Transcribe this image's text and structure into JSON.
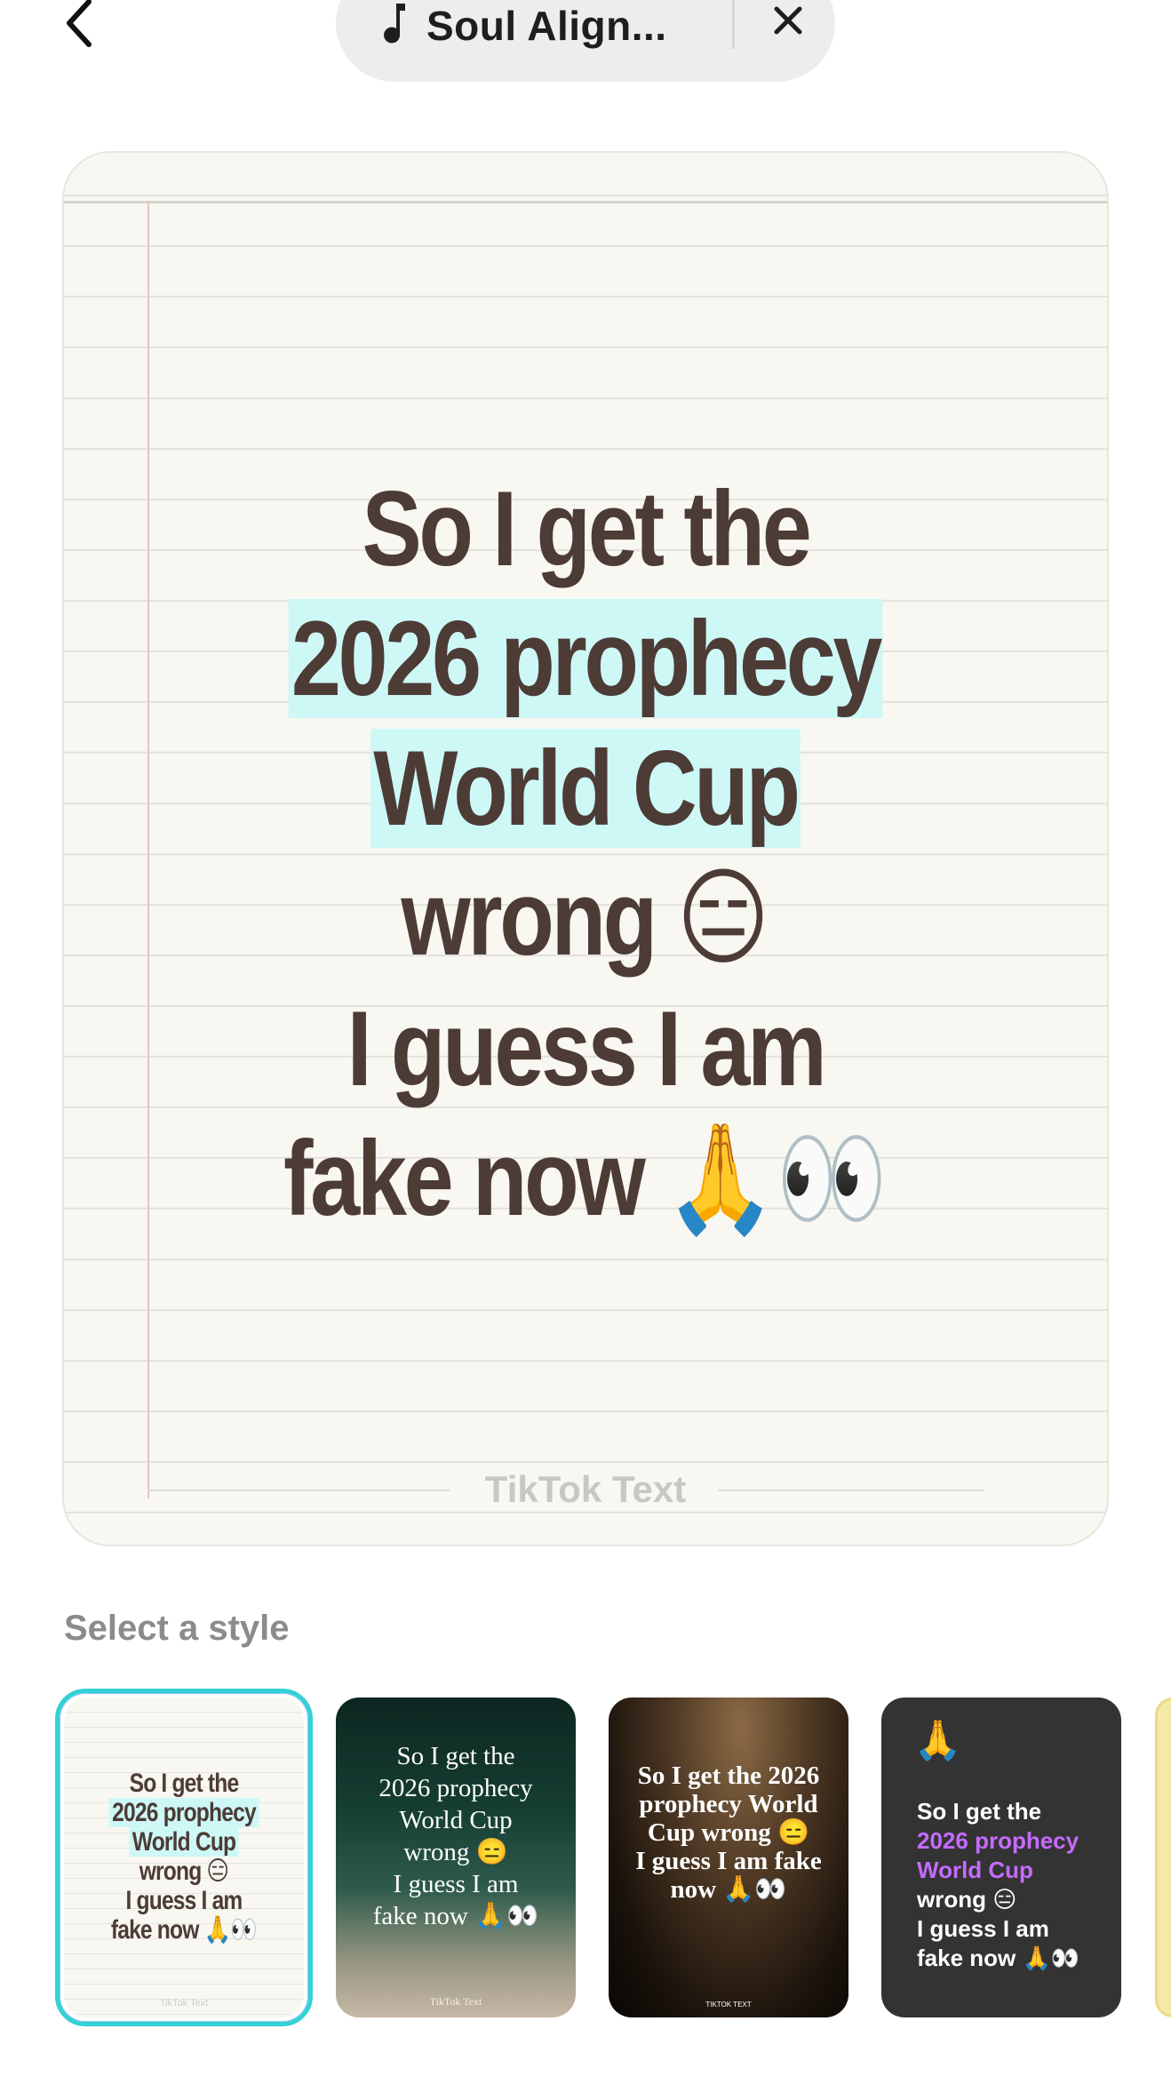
{
  "header": {
    "music_title": "Soul Align..."
  },
  "preview": {
    "lines": [
      {
        "pre": "So I get the",
        "hl": "",
        "post": ""
      },
      {
        "pre": "",
        "hl": "2026 prophecy",
        "post": ""
      },
      {
        "pre": "",
        "hl": "World Cup",
        "post": ""
      },
      {
        "pre": "wrong ",
        "hl": "",
        "post": "😑"
      },
      {
        "pre": "I guess I am",
        "hl": "",
        "post": ""
      },
      {
        "pre": "fake now ",
        "hl": "",
        "post": "🙏👀"
      }
    ],
    "watermark": "TikTok Text"
  },
  "styles": {
    "label": "Select a style",
    "thumb1": {
      "lines": [
        "So I get the",
        "2026 prophecy",
        "World Cup",
        "wrong 😑",
        "I guess I am",
        "fake now 🙏👀"
      ],
      "footer": "TikTok Text"
    },
    "thumb2": {
      "lines": [
        "So I get the",
        "2026 prophecy",
        "World Cup",
        "wrong 😑",
        "I guess I am",
        "fake now 🙏👀"
      ],
      "footer": "TikTok Text"
    },
    "thumb3": {
      "lines": [
        "So I get the 2026",
        "prophecy World",
        "Cup wrong 😑",
        "I guess I am fake",
        "now 🙏👀"
      ],
      "footer": "TIKTOK TEXT"
    },
    "thumb4": {
      "emoji": "🙏",
      "line1": "So I get the",
      "purple1": "2026 prophecy",
      "purple2": "World Cup",
      "line4": "wrong 😑",
      "line5": "I guess I am",
      "line6": "fake now 🙏👀"
    }
  },
  "colors": {
    "text_brown": "#4d3b36",
    "highlight_cyan": "#cdf8f6",
    "selected_ring": "#34d1d3",
    "purple_accent": "#c56bff"
  }
}
